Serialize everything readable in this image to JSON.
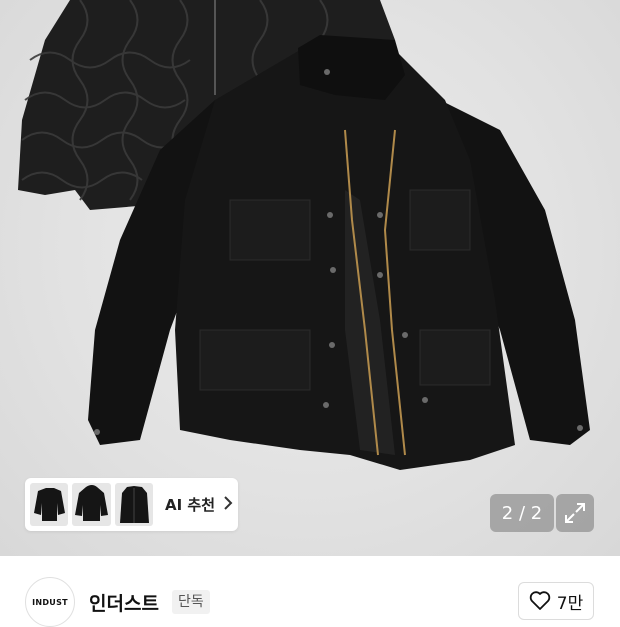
{
  "gallery": {
    "pager_text": "2 / 2",
    "expand_icon": "expand-icon"
  },
  "recommend": {
    "label": "AI 추천",
    "chevron_icon": "chevron-right-icon",
    "thumbnails": [
      "thumbnail-1",
      "thumbnail-2",
      "thumbnail-3"
    ]
  },
  "shop": {
    "logo_text": "INDUST",
    "name": "인더스트",
    "badge": "단독"
  },
  "like": {
    "icon": "heart-icon",
    "count": "7만"
  },
  "colors": {
    "hero_bg": "#e2e2e2",
    "jacket": "#141414",
    "zipper": "#b08a4a",
    "pager_bg": "#787878"
  }
}
